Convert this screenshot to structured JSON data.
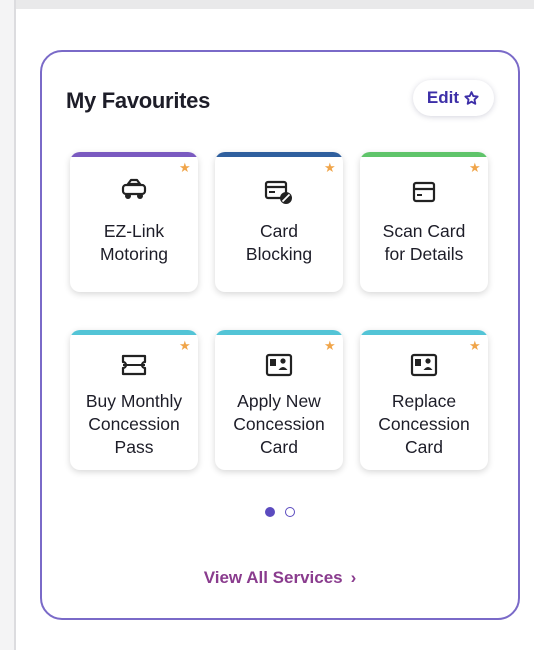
{
  "favourites": {
    "title": "My Favourites",
    "edit_label": "Edit",
    "tiles": [
      {
        "label_line1": "EZ-Link",
        "label_line2": "Motoring",
        "label_line3": "",
        "icon": "car-icon",
        "stripe": "#7a5ac0"
      },
      {
        "label_line1": "Card",
        "label_line2": "Blocking",
        "label_line3": "",
        "icon": "card-block-icon",
        "stripe": "#2f5f9e"
      },
      {
        "label_line1": "Scan Card",
        "label_line2": "for Details",
        "label_line3": "",
        "icon": "card-icon",
        "stripe": "#5fc46a"
      },
      {
        "label_line1": "Buy Monthly",
        "label_line2": "Concession",
        "label_line3": "Pass",
        "icon": "ticket-icon",
        "stripe": "#53c4d6"
      },
      {
        "label_line1": "Apply New",
        "label_line2": "Concession",
        "label_line3": "Card",
        "icon": "id-card-icon",
        "stripe": "#53c4d6"
      },
      {
        "label_line1": "Replace",
        "label_line2": "Concession",
        "label_line3": "Card",
        "icon": "id-card-icon",
        "stripe": "#53c4d6"
      }
    ],
    "pagination": {
      "pages": 2,
      "current": 1
    },
    "view_all_label": "View All Services",
    "colors": {
      "accent": "#5b4bbf",
      "border": "#7a6ac8",
      "star": "#f0a54a",
      "link": "#8a3c8e"
    }
  }
}
